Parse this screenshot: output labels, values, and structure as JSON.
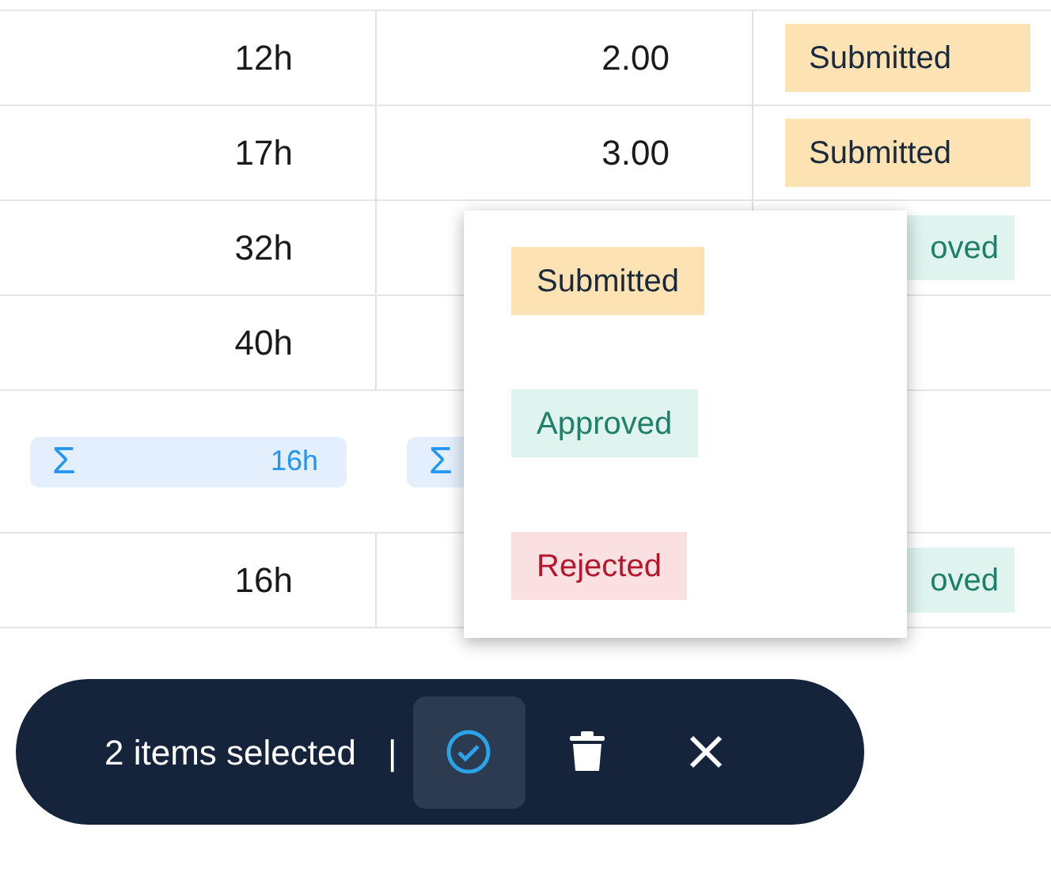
{
  "table": {
    "rows": [
      {
        "kind": "data",
        "hours": "12h",
        "amount": "2.00",
        "status": {
          "label": "Submitted",
          "color": "#fde3b3"
        }
      },
      {
        "kind": "data",
        "hours": "17h",
        "amount": "3.00",
        "status": {
          "label": "Submitted",
          "color": "#fde3b3"
        }
      },
      {
        "kind": "data",
        "hours": "32h",
        "status": {
          "label": "oved",
          "color": "#dff3ef",
          "partial": true
        }
      },
      {
        "kind": "data",
        "hours": "40h"
      },
      {
        "kind": "summary",
        "totals": [
          {
            "symbol": "Σ",
            "value": "16h"
          },
          {
            "symbol": "Σ"
          }
        ]
      },
      {
        "kind": "data",
        "hours": "16h",
        "status": {
          "label": "oved",
          "color": "#dff3ef",
          "partial": true
        }
      }
    ]
  },
  "status_menu": {
    "options": [
      {
        "label": "Submitted",
        "color": "#fde3b3"
      },
      {
        "label": "Approved",
        "color": "#dff3ef"
      },
      {
        "label": "Rejected",
        "color": "#fae0e0"
      }
    ]
  },
  "selection_bar": {
    "count_text": "2 items selected",
    "separator": "|",
    "actions": [
      {
        "kind": "approve",
        "active": true
      },
      {
        "kind": "delete",
        "active": false
      },
      {
        "kind": "close",
        "active": false
      }
    ]
  }
}
